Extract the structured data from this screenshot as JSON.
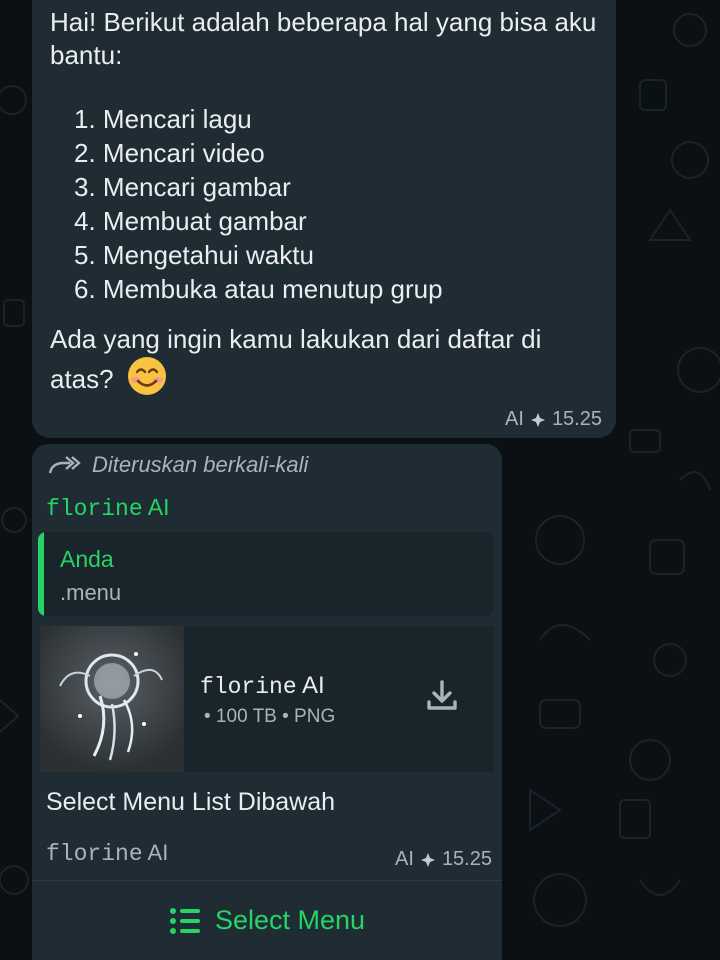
{
  "message1": {
    "intro": "Hai! Berikut adalah beberapa hal yang bisa aku bantu:",
    "list": [
      "1. Mencari lagu",
      "2. Mencari video",
      "3. Mencari gambar",
      "4. Membuat gambar",
      "5. Mengetahui waktu",
      "6. Membuka atau menutup grup"
    ],
    "question": "Ada yang ingin kamu lakukan dari daftar di atas?",
    "emoji": "smiling-face-emoji",
    "meta_label": "AI",
    "time": "15.25"
  },
  "message2": {
    "forwarded_label": "Diteruskan berkali-kali",
    "sender_mono": "florine",
    "sender_suffix": "AI",
    "quote": {
      "name": "Anda",
      "text": ".menu"
    },
    "document": {
      "title_mono": "florine",
      "title_suffix": "AI",
      "meta": "• 100 TB • PNG",
      "download_icon": "download-icon"
    },
    "caption": "Select Menu List Dibawah",
    "footer_mono": "florine",
    "footer_suffix": "AI",
    "meta_label": "AI",
    "time": "15.25",
    "button_label": "Select Menu"
  },
  "colors": {
    "background": "#0b1014",
    "bubble": "#1f2c33",
    "accent": "#25d366",
    "muted": "#a8b3ba"
  }
}
